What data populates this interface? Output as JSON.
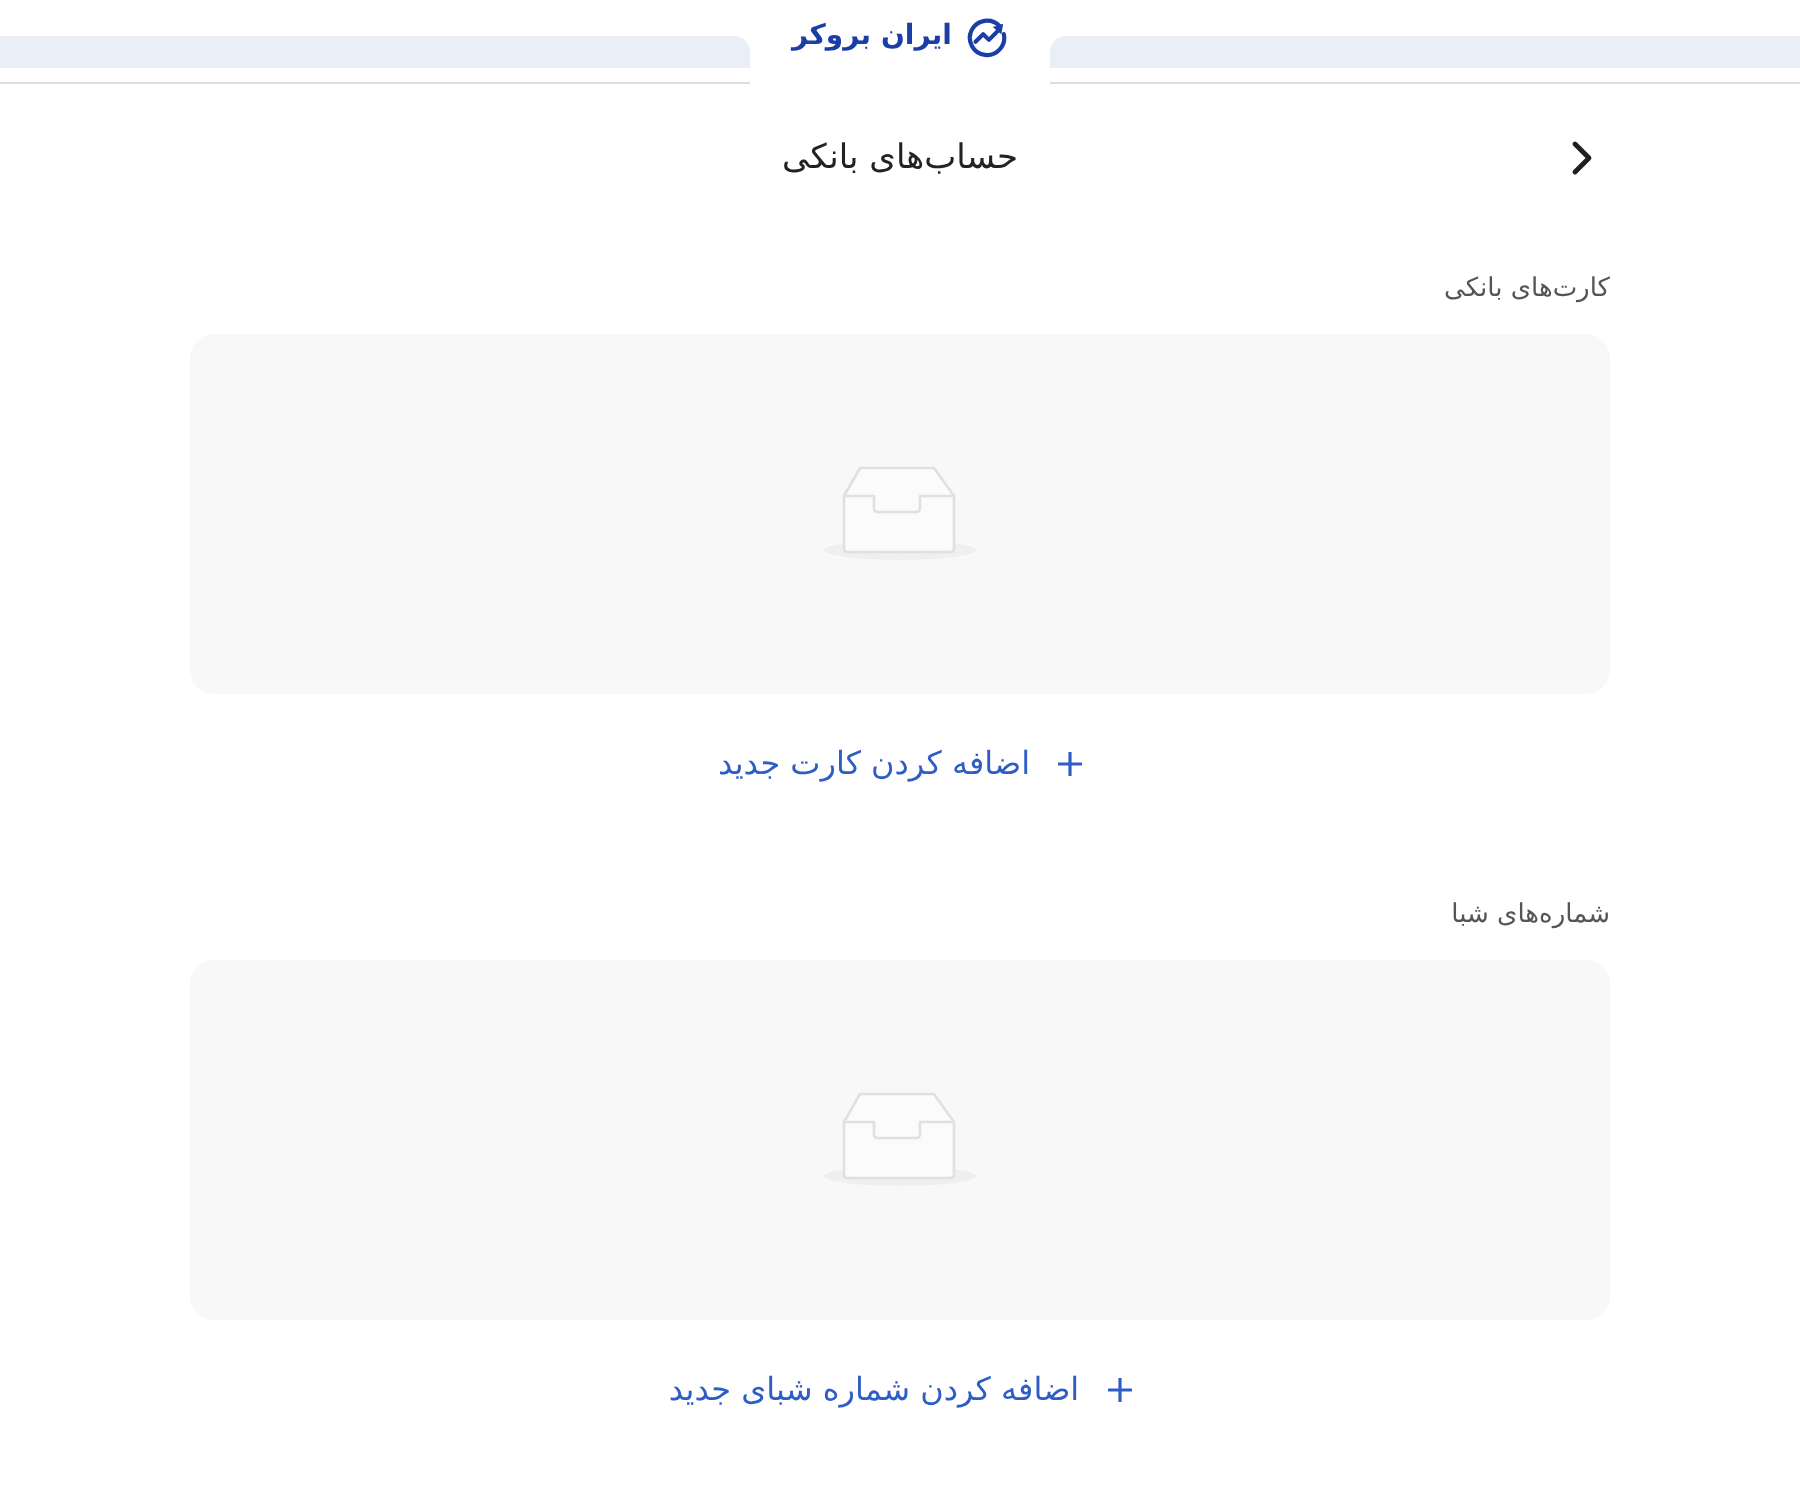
{
  "top_bar": {
    "logo_text": "ایران بروکر"
  },
  "header": {
    "title": "حساب‌های بانکی"
  },
  "sections": [
    {
      "label": "کارت‌های بانکی",
      "add_button": "اضافه کردن کارت جدید"
    },
    {
      "label": "شماره‌های شبا",
      "add_button": "اضافه کردن شماره شبای جدید"
    }
  ]
}
